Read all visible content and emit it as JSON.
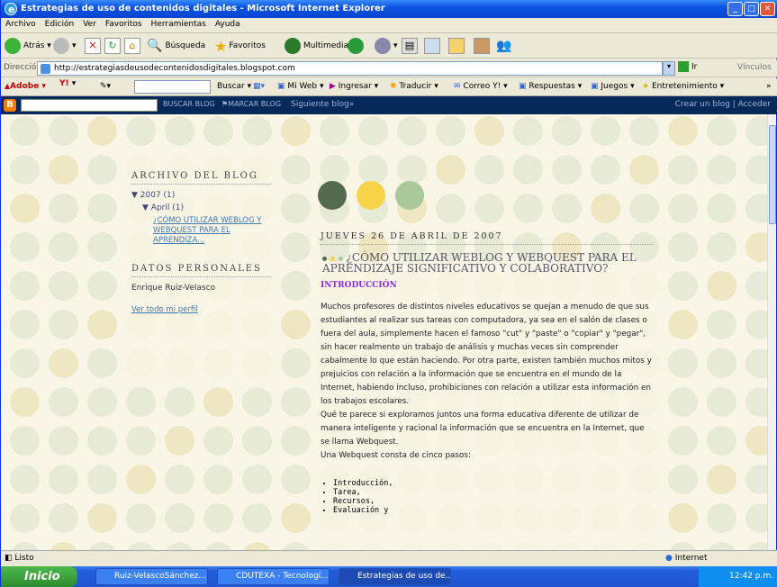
{
  "window": {
    "title": "Estrategias de uso de contenidos digitales - Microsoft Internet Explorer"
  },
  "menu": [
    "Archivo",
    "Edición",
    "Ver",
    "Favoritos",
    "Herramientas",
    "Ayuda"
  ],
  "toolbar": {
    "back": "Atrás",
    "search": "Búsqueda",
    "favorites": "Favoritos",
    "media": "Multimedia"
  },
  "address": {
    "label": "Dirección",
    "url": "http://estrategiasdeusodecontenidosdigitales.blogspot.com",
    "go": "Ir",
    "links": "Vínculos"
  },
  "yahoo": {
    "adobe": "Adobe",
    "search_btn": "Buscar",
    "myweb": "Mi Web",
    "ingresar": "Ingresar",
    "traducir": "Traducir",
    "correo": "Correo Y!",
    "respuestas": "Respuestas",
    "juegos": "Juegos",
    "entretenimiento": "Entretenimiento"
  },
  "blogger": {
    "search_btn": "BUSCAR BLOG",
    "flag_btn": "MARCAR BLOG",
    "next": "Siguiente blog»",
    "right": "Crear un blog | Acceder"
  },
  "sidebar": {
    "archive_title": "ARCHIVO DEL BLOG",
    "year": "▼ 2007 (1)",
    "month": "▼ April (1)",
    "post_link": "¿CÓMO UTILIZAR WEBLOG Y WEBQUEST PARA EL APRENDIZA...",
    "personal_title": "DATOS PERSONALES",
    "author": "Enrique Ruiz-Velasco",
    "profile_link": "Ver todo mi perfil"
  },
  "post": {
    "date": "JUEVES 26 DE ABRIL DE 2007",
    "title": "¿CÓMO UTILIZAR WEBLOG Y WEBQUEST PARA EL APRENDIZAJE SIGNIFICATIVO Y COLABORATIVO?",
    "intro": "INTRODUCCIÓN",
    "p1": "Muchos profesores de distintos niveles educativos se quejan a menudo de que sus estudiantes al realizar sus tareas con computadora, ya sea en el salón de clases o fuera del aula, simplemente hacen el famoso \"cut\" y \"paste\" o \"copiar\" y \"pegar\", sin hacer realmente un trabajo de análisis y muchas veces sin comprender cabalmente lo que están haciendo. Por otra parte, existen también muchos mitos y prejuicios con relación a la información que se encuentra en el mundo de la Internet, habiendo incluso, prohibiciones con relación a utilizar esta información en los trabajos escolares.",
    "p2": "Qué te parece si exploramos juntos una forma educativa diferente de utilizar de manera inteligente y racional la información que se encuentra en la Internet, que se llama Webquest.",
    "p3": "Una Webquest consta de cinco pasos:",
    "list": [
      "Introducción,",
      "Tarea,",
      "Recursos,",
      "Evaluación y"
    ]
  },
  "status": {
    "left": "Listo",
    "zone": "Internet"
  },
  "taskbar": {
    "start": "Inicio",
    "tasks": [
      "Ruiz-VelascoSánchez...",
      "CDUTEXA - Tecnologí...",
      "Estrategias de uso de..."
    ],
    "clock": "12:42 p.m."
  },
  "colors": {
    "dot_green_dark": "#556b4f",
    "dot_yellow": "#f6d348",
    "dot_green_light": "#a9c99a"
  }
}
